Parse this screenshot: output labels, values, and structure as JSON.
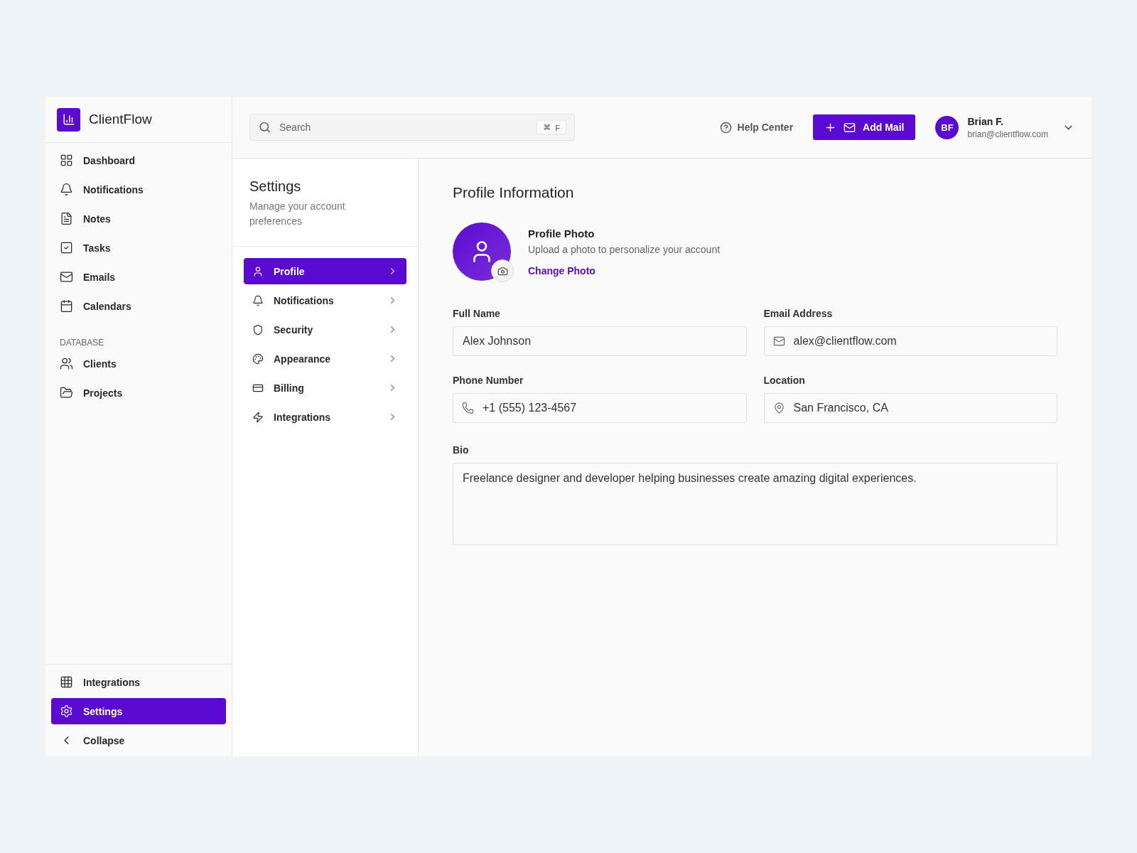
{
  "brand": {
    "name": "ClientFlow"
  },
  "sidebar": {
    "main_items": [
      {
        "label": "Dashboard",
        "selected": false
      },
      {
        "label": "Notifications",
        "selected": false
      },
      {
        "label": "Notes",
        "selected": false
      },
      {
        "label": "Tasks",
        "selected": false
      },
      {
        "label": "Emails",
        "selected": false
      },
      {
        "label": "Calendars",
        "selected": false
      }
    ],
    "section_title": "DATABASE",
    "database_items": [
      {
        "label": "Clients",
        "selected": false
      },
      {
        "label": "Projects",
        "selected": false
      }
    ],
    "bottom_items": [
      {
        "label": "Integrations",
        "selected": false
      },
      {
        "label": "Settings",
        "selected": true
      }
    ],
    "collapse": "Collapse"
  },
  "topbar": {
    "search": {
      "placeholder": "Search",
      "shortcut_symbol": "⌘",
      "shortcut_key": "F"
    },
    "help": "Help Center",
    "add_button": "Add Mail",
    "user": {
      "initials": "BF",
      "name": "Brian F.",
      "email": "brian@clientflow.com"
    }
  },
  "settings_nav": {
    "title": "Settings",
    "subtitle": "Manage your account preferences",
    "items": [
      {
        "label": "Profile",
        "selected": true
      },
      {
        "label": "Notifications",
        "selected": false
      },
      {
        "label": "Security",
        "selected": false
      },
      {
        "label": "Appearance",
        "selected": false
      },
      {
        "label": "Billing",
        "selected": false
      },
      {
        "label": "Integrations",
        "selected": false
      }
    ]
  },
  "profile": {
    "title": "Profile Information",
    "photo_title": "Profile Photo",
    "photo_hint": "Upload a photo to personalize your account",
    "change_photo": "Change Photo",
    "fields": [
      {
        "label": "Full Name",
        "value": "Alex Johnson",
        "kind": "plain"
      },
      {
        "label": "Email Address",
        "value": "alex@clientflow.com",
        "kind": "email"
      },
      {
        "label": "Phone Number",
        "value": "+1 (555) 123-4567",
        "kind": "phone"
      },
      {
        "label": "Location",
        "value": "San Francisco, CA",
        "kind": "location"
      }
    ],
    "bio": {
      "label": "Bio",
      "value": "Freelance designer and developer helping businesses create amazing digital experiences."
    }
  }
}
